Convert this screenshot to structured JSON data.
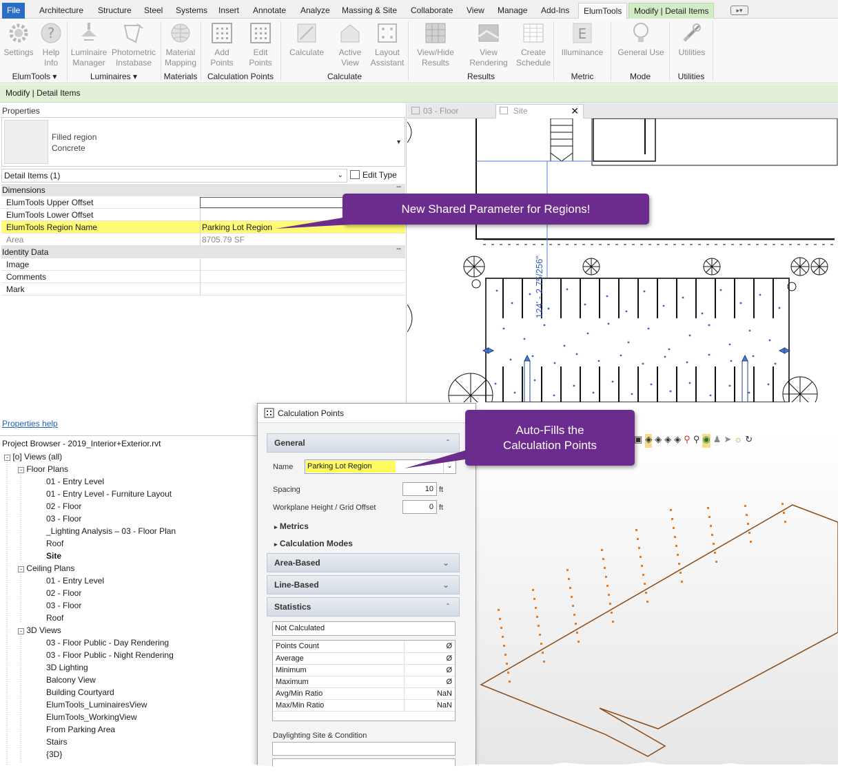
{
  "ribbon_tabs": [
    "File",
    "Architecture",
    "Structure",
    "Steel",
    "Systems",
    "Insert",
    "Annotate",
    "Analyze",
    "Massing & Site",
    "Collaborate",
    "View",
    "Manage",
    "Add-Ins",
    "ElumTools",
    "Modify | Detail Items"
  ],
  "ribbon": {
    "buttons": [
      {
        "l1": "Settings",
        "l2": ""
      },
      {
        "l1": "Help",
        "l2": "Info"
      },
      {
        "l1": "Luminaire",
        "l2": "Manager"
      },
      {
        "l1": "Photometric",
        "l2": "Instabase"
      },
      {
        "l1": "Material",
        "l2": "Mapping"
      },
      {
        "l1": "Add",
        "l2": "Points"
      },
      {
        "l1": "Edit",
        "l2": "Points"
      },
      {
        "l1": "Calculate",
        "l2": ""
      },
      {
        "l1": "Active",
        "l2": "View"
      },
      {
        "l1": "Layout",
        "l2": "Assistant"
      },
      {
        "l1": "View/Hide",
        "l2": "Results"
      },
      {
        "l1": "View",
        "l2": "Rendering"
      },
      {
        "l1": "Create",
        "l2": "Schedule"
      },
      {
        "l1": "Illuminance",
        "l2": ""
      },
      {
        "l1": "General Use",
        "l2": ""
      },
      {
        "l1": "Utilities",
        "l2": ""
      }
    ],
    "panels": [
      "ElumTools",
      "Luminaires",
      "Materials",
      "Calculation Points",
      "Calculate",
      "Results",
      "Metric",
      "Mode",
      "Utilities"
    ]
  },
  "modify_bar": "Modify | Detail Items",
  "properties": {
    "title": "Properties",
    "type_line1": "Filled region",
    "type_line2": "Concrete",
    "selector": "Detail Items (1)",
    "edit_type": "Edit Type",
    "groups": {
      "dimensions": "Dimensions",
      "identity": "Identity Data"
    },
    "rows": {
      "upper_offset": "ElumTools Upper Offset",
      "lower_offset": "ElumTools Lower Offset",
      "region_name": "ElumTools Region Name",
      "region_value": "Parking Lot Region",
      "area": "Area",
      "area_value": "8705.79 SF",
      "image": "Image",
      "comments": "Comments",
      "mark": "Mark"
    },
    "help": "Properties help"
  },
  "browser": {
    "title": "Project Browser - 2019_Interior+Exterior.rvt",
    "root": "Views (all)",
    "floor_plans": "Floor Plans",
    "fp_items": [
      "01 - Entry Level",
      "01 - Entry Level - Furniture Layout",
      "02 - Floor",
      "03 - Floor",
      "_Lighting Analysis – 03 - Floor Plan",
      "Roof",
      "Site"
    ],
    "ceiling_plans": "Ceiling Plans",
    "cp_items": [
      "01 - Entry Level",
      "02 - Floor",
      "03 - Floor",
      "Roof"
    ],
    "views_3d": "3D Views",
    "v3_items": [
      "03 - Floor Public - Day Rendering",
      "03 - Floor Public - Night Rendering",
      "3D Lighting",
      "Balcony View",
      "Building Courtyard",
      "ElumTools_LuminairesView",
      "ElumTools_WorkingView",
      "From Parking Area",
      "Stairs",
      "{3D}"
    ]
  },
  "view_tabs": {
    "tab1": "03 - Floor",
    "tab2": "Site"
  },
  "plan_dimension": "124' - 2 75/256\"",
  "dialog": {
    "title": "Calculation Points",
    "general": "General",
    "name_label": "Name",
    "name_value": "Parking Lot Region",
    "spacing_label": "Spacing",
    "spacing_value": "10",
    "spacing_unit": "ft",
    "workplane_label": "Workplane Height / Grid Offset",
    "workplane_value": "0",
    "workplane_unit": "ft",
    "metrics": "Metrics",
    "calc_modes": "Calculation Modes",
    "area_based": "Area-Based",
    "line_based": "Line-Based",
    "statistics": "Statistics",
    "status": "Not Calculated",
    "stats": [
      {
        "k": "Points Count",
        "v": "Ø"
      },
      {
        "k": "Average",
        "v": "Ø"
      },
      {
        "k": "Minimum",
        "v": "Ø"
      },
      {
        "k": "Maximum",
        "v": "Ø"
      },
      {
        "k": "Avg/Min Ratio",
        "v": "NaN"
      },
      {
        "k": "Max/Min Ratio",
        "v": "NaN"
      }
    ],
    "daylighting": "Daylighting Site & Condition"
  },
  "callouts": {
    "one": "New Shared Parameter for Regions!",
    "two_l1": "Auto-Fills the",
    "two_l2": "Calculation Points"
  },
  "colors": {
    "callout": "#6b2c8d",
    "highlight": "#ffff66",
    "file_tab": "#2b6cc4",
    "context_tab": "#d4ecc6",
    "points": "#e87a1e",
    "region_outline": "#8a4a14"
  }
}
